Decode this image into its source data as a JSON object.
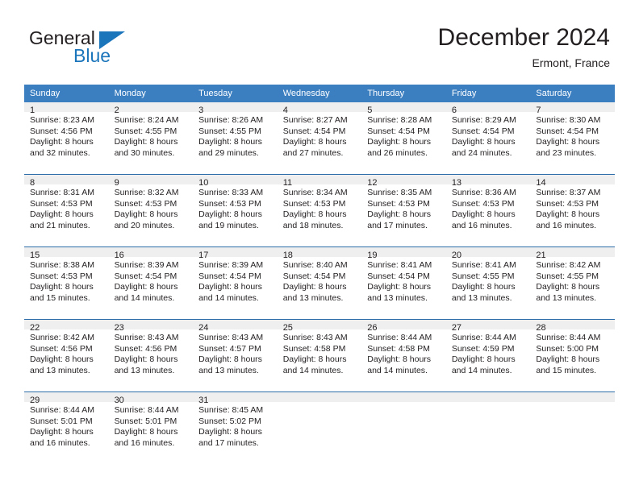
{
  "brand": {
    "name_dark": "General",
    "name_blue": "Blue",
    "accent_color": "#1b75bb"
  },
  "header": {
    "month_title": "December 2024",
    "location": "Ermont, France"
  },
  "calendar": {
    "header_bg": "#3c7fc1",
    "row_separator_color": "#2c6ca8",
    "daynum_bg": "#efefef",
    "weekday_headers": [
      "Sunday",
      "Monday",
      "Tuesday",
      "Wednesday",
      "Thursday",
      "Friday",
      "Saturday"
    ],
    "weeks": [
      [
        {
          "day": "1",
          "sunrise": "Sunrise: 8:23 AM",
          "sunset": "Sunset: 4:56 PM",
          "daylight_line1": "Daylight: 8 hours",
          "daylight_line2": "and 32 minutes."
        },
        {
          "day": "2",
          "sunrise": "Sunrise: 8:24 AM",
          "sunset": "Sunset: 4:55 PM",
          "daylight_line1": "Daylight: 8 hours",
          "daylight_line2": "and 30 minutes."
        },
        {
          "day": "3",
          "sunrise": "Sunrise: 8:26 AM",
          "sunset": "Sunset: 4:55 PM",
          "daylight_line1": "Daylight: 8 hours",
          "daylight_line2": "and 29 minutes."
        },
        {
          "day": "4",
          "sunrise": "Sunrise: 8:27 AM",
          "sunset": "Sunset: 4:54 PM",
          "daylight_line1": "Daylight: 8 hours",
          "daylight_line2": "and 27 minutes."
        },
        {
          "day": "5",
          "sunrise": "Sunrise: 8:28 AM",
          "sunset": "Sunset: 4:54 PM",
          "daylight_line1": "Daylight: 8 hours",
          "daylight_line2": "and 26 minutes."
        },
        {
          "day": "6",
          "sunrise": "Sunrise: 8:29 AM",
          "sunset": "Sunset: 4:54 PM",
          "daylight_line1": "Daylight: 8 hours",
          "daylight_line2": "and 24 minutes."
        },
        {
          "day": "7",
          "sunrise": "Sunrise: 8:30 AM",
          "sunset": "Sunset: 4:54 PM",
          "daylight_line1": "Daylight: 8 hours",
          "daylight_line2": "and 23 minutes."
        }
      ],
      [
        {
          "day": "8",
          "sunrise": "Sunrise: 8:31 AM",
          "sunset": "Sunset: 4:53 PM",
          "daylight_line1": "Daylight: 8 hours",
          "daylight_line2": "and 21 minutes."
        },
        {
          "day": "9",
          "sunrise": "Sunrise: 8:32 AM",
          "sunset": "Sunset: 4:53 PM",
          "daylight_line1": "Daylight: 8 hours",
          "daylight_line2": "and 20 minutes."
        },
        {
          "day": "10",
          "sunrise": "Sunrise: 8:33 AM",
          "sunset": "Sunset: 4:53 PM",
          "daylight_line1": "Daylight: 8 hours",
          "daylight_line2": "and 19 minutes."
        },
        {
          "day": "11",
          "sunrise": "Sunrise: 8:34 AM",
          "sunset": "Sunset: 4:53 PM",
          "daylight_line1": "Daylight: 8 hours",
          "daylight_line2": "and 18 minutes."
        },
        {
          "day": "12",
          "sunrise": "Sunrise: 8:35 AM",
          "sunset": "Sunset: 4:53 PM",
          "daylight_line1": "Daylight: 8 hours",
          "daylight_line2": "and 17 minutes."
        },
        {
          "day": "13",
          "sunrise": "Sunrise: 8:36 AM",
          "sunset": "Sunset: 4:53 PM",
          "daylight_line1": "Daylight: 8 hours",
          "daylight_line2": "and 16 minutes."
        },
        {
          "day": "14",
          "sunrise": "Sunrise: 8:37 AM",
          "sunset": "Sunset: 4:53 PM",
          "daylight_line1": "Daylight: 8 hours",
          "daylight_line2": "and 16 minutes."
        }
      ],
      [
        {
          "day": "15",
          "sunrise": "Sunrise: 8:38 AM",
          "sunset": "Sunset: 4:53 PM",
          "daylight_line1": "Daylight: 8 hours",
          "daylight_line2": "and 15 minutes."
        },
        {
          "day": "16",
          "sunrise": "Sunrise: 8:39 AM",
          "sunset": "Sunset: 4:54 PM",
          "daylight_line1": "Daylight: 8 hours",
          "daylight_line2": "and 14 minutes."
        },
        {
          "day": "17",
          "sunrise": "Sunrise: 8:39 AM",
          "sunset": "Sunset: 4:54 PM",
          "daylight_line1": "Daylight: 8 hours",
          "daylight_line2": "and 14 minutes."
        },
        {
          "day": "18",
          "sunrise": "Sunrise: 8:40 AM",
          "sunset": "Sunset: 4:54 PM",
          "daylight_line1": "Daylight: 8 hours",
          "daylight_line2": "and 13 minutes."
        },
        {
          "day": "19",
          "sunrise": "Sunrise: 8:41 AM",
          "sunset": "Sunset: 4:54 PM",
          "daylight_line1": "Daylight: 8 hours",
          "daylight_line2": "and 13 minutes."
        },
        {
          "day": "20",
          "sunrise": "Sunrise: 8:41 AM",
          "sunset": "Sunset: 4:55 PM",
          "daylight_line1": "Daylight: 8 hours",
          "daylight_line2": "and 13 minutes."
        },
        {
          "day": "21",
          "sunrise": "Sunrise: 8:42 AM",
          "sunset": "Sunset: 4:55 PM",
          "daylight_line1": "Daylight: 8 hours",
          "daylight_line2": "and 13 minutes."
        }
      ],
      [
        {
          "day": "22",
          "sunrise": "Sunrise: 8:42 AM",
          "sunset": "Sunset: 4:56 PM",
          "daylight_line1": "Daylight: 8 hours",
          "daylight_line2": "and 13 minutes."
        },
        {
          "day": "23",
          "sunrise": "Sunrise: 8:43 AM",
          "sunset": "Sunset: 4:56 PM",
          "daylight_line1": "Daylight: 8 hours",
          "daylight_line2": "and 13 minutes."
        },
        {
          "day": "24",
          "sunrise": "Sunrise: 8:43 AM",
          "sunset": "Sunset: 4:57 PM",
          "daylight_line1": "Daylight: 8 hours",
          "daylight_line2": "and 13 minutes."
        },
        {
          "day": "25",
          "sunrise": "Sunrise: 8:43 AM",
          "sunset": "Sunset: 4:58 PM",
          "daylight_line1": "Daylight: 8 hours",
          "daylight_line2": "and 14 minutes."
        },
        {
          "day": "26",
          "sunrise": "Sunrise: 8:44 AM",
          "sunset": "Sunset: 4:58 PM",
          "daylight_line1": "Daylight: 8 hours",
          "daylight_line2": "and 14 minutes."
        },
        {
          "day": "27",
          "sunrise": "Sunrise: 8:44 AM",
          "sunset": "Sunset: 4:59 PM",
          "daylight_line1": "Daylight: 8 hours",
          "daylight_line2": "and 14 minutes."
        },
        {
          "day": "28",
          "sunrise": "Sunrise: 8:44 AM",
          "sunset": "Sunset: 5:00 PM",
          "daylight_line1": "Daylight: 8 hours",
          "daylight_line2": "and 15 minutes."
        }
      ],
      [
        {
          "day": "29",
          "sunrise": "Sunrise: 8:44 AM",
          "sunset": "Sunset: 5:01 PM",
          "daylight_line1": "Daylight: 8 hours",
          "daylight_line2": "and 16 minutes."
        },
        {
          "day": "30",
          "sunrise": "Sunrise: 8:44 AM",
          "sunset": "Sunset: 5:01 PM",
          "daylight_line1": "Daylight: 8 hours",
          "daylight_line2": "and 16 minutes."
        },
        {
          "day": "31",
          "sunrise": "Sunrise: 8:45 AM",
          "sunset": "Sunset: 5:02 PM",
          "daylight_line1": "Daylight: 8 hours",
          "daylight_line2": "and 17 minutes."
        },
        {
          "day": "",
          "sunrise": "",
          "sunset": "",
          "daylight_line1": "",
          "daylight_line2": ""
        },
        {
          "day": "",
          "sunrise": "",
          "sunset": "",
          "daylight_line1": "",
          "daylight_line2": ""
        },
        {
          "day": "",
          "sunrise": "",
          "sunset": "",
          "daylight_line1": "",
          "daylight_line2": ""
        },
        {
          "day": "",
          "sunrise": "",
          "sunset": "",
          "daylight_line1": "",
          "daylight_line2": ""
        }
      ]
    ]
  }
}
